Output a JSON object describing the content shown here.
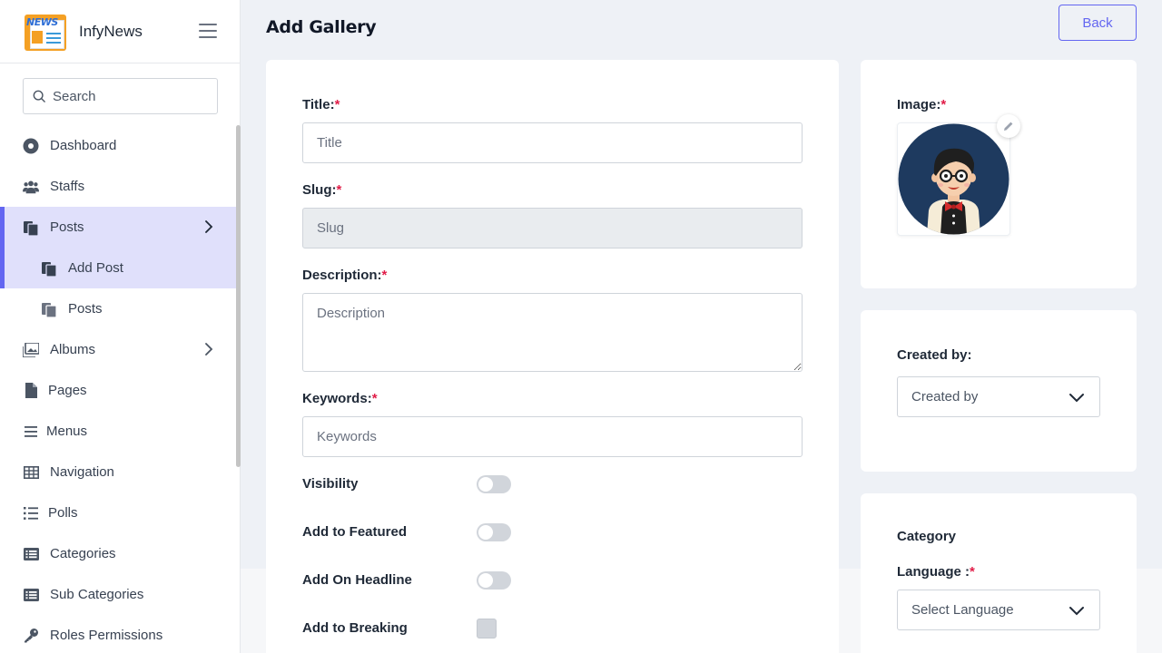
{
  "sidebar": {
    "brand_name": "InfyNews",
    "logo_text": "NEWS",
    "search_placeholder": "Search",
    "items": [
      {
        "label": "Dashboard"
      },
      {
        "label": "Staffs"
      },
      {
        "label": "Posts"
      },
      {
        "label": "Add Post"
      },
      {
        "label": "Posts"
      },
      {
        "label": "Albums"
      },
      {
        "label": "Pages"
      },
      {
        "label": "Menus"
      },
      {
        "label": "Navigation"
      },
      {
        "label": "Polls"
      },
      {
        "label": "Categories"
      },
      {
        "label": "Sub Categories"
      },
      {
        "label": "Roles Permissions"
      }
    ]
  },
  "header": {
    "title": "Add Gallery",
    "back_label": "Back"
  },
  "form": {
    "title_label": "Title:",
    "title_placeholder": "Title",
    "slug_label": "Slug:",
    "slug_placeholder": "Slug",
    "description_label": "Description:",
    "description_placeholder": "Description",
    "keywords_label": "Keywords:",
    "keywords_placeholder": "Keywords",
    "required_mark": "*",
    "visibility_label": "Visibility",
    "featured_label": "Add to Featured",
    "headline_label": "Add On Headline",
    "breaking_label": "Add to Breaking"
  },
  "image_card": {
    "label": "Image:"
  },
  "created_card": {
    "label": "Created by:",
    "selected": "Created by"
  },
  "category_card": {
    "title": "Category",
    "language_label": "Language :",
    "language_selected": "Select Language"
  },
  "colors": {
    "accent": "#6366f1",
    "active_bg": "#e0e0fb",
    "required": "#e11d48",
    "avatar_bg": "#1e3a5f"
  }
}
